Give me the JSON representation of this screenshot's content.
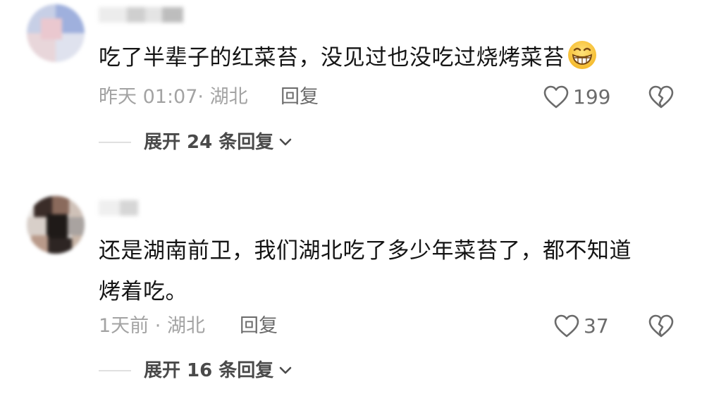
{
  "comments": [
    {
      "text": "吃了半辈子的红菜苔，没见过也没吃过烧烤菜苔",
      "emoji": "grin-emoji",
      "time": "昨天 01:07",
      "location": "· 湖北",
      "reply_label": "回复",
      "likes": "199",
      "expand_label": "展开 24 条回复"
    },
    {
      "text_line1": "还是湖南前卫，我们湖北吃了多少年菜苔了，都不知道",
      "text_line2": "烤着吃。",
      "time": "1天前",
      "location": "· 湖北",
      "reply_label": "回复",
      "likes": "37",
      "expand_label": "展开 16 条回复"
    }
  ],
  "colors": {
    "text": "#141414",
    "meta": "#a3a3a3",
    "action": "#6b6b6b",
    "divider": "#e0e0e0"
  },
  "icons": [
    "heart-outline-icon",
    "broken-heart-icon",
    "chevron-down-icon",
    "grin-emoji"
  ]
}
